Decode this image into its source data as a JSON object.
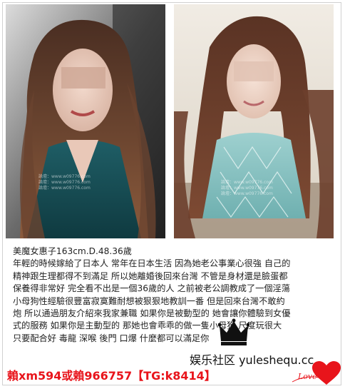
{
  "photos": {
    "left": {
      "watermark": [
        "論壇：www.w09776.com",
        "論壇：www.w09776.com",
        "論壇：www.w09776.com"
      ]
    },
    "right": {
      "watermark": [
        "論壇：www.w09776.com",
        "論壇：www.w09776.com",
        "論壇：www.w09776.com"
      ]
    }
  },
  "post": {
    "title": "美魔女惠子163cm.D.48.36歲",
    "lines": [
      "年輕的時候嫁給了日本人 常年在日本生活 因為她老公事業心很強 自己的",
      "精神跟生理都得不到滿足 所以她離婚後回來台灣 不管是身材還是臉蛋都",
      "保養得非常好 完全看不出是一個36歲的人 之前被老公調教成了一個淫蕩",
      "小母狗性經驗很豐富寂寞難耐想被狠狠地教訓一番 但是回來台灣不敢約",
      "炮 所以通過朋友介紹來我家兼職 如果你是被動型的 她會讓你體驗到女優",
      "式的服務 如果你是主動型的 那她也會乖乖的做一隻小母狗 尺度玩很大",
      "只要配合好 毒龍 深喉 後門 口爆 什麼都可以滿足你"
    ]
  },
  "contact": "賴xm594或賴966757【TG:k8414】",
  "site_label": "娱乐社区 yuleshequ.cc",
  "badge": {
    "text": "Love",
    "icon": "heart-icon",
    "crown_icon": "crown-icon"
  },
  "colors": {
    "accent": "#e8141b",
    "text": "#222222"
  }
}
